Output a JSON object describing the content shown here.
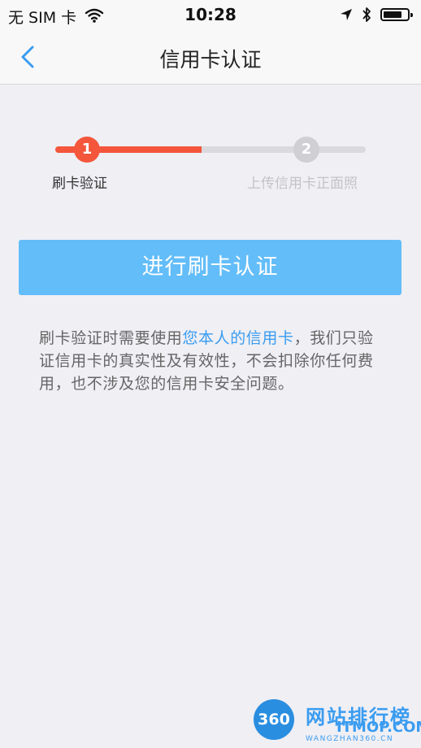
{
  "status_bar": {
    "carrier": "无 SIM 卡",
    "time": "10:28",
    "icons": [
      "wifi-icon",
      "location-arrow-icon",
      "bluetooth-icon",
      "battery-icon"
    ]
  },
  "nav": {
    "back_icon": "chevron-left-icon",
    "title": "信用卡认证"
  },
  "steps": {
    "progress": 0.47,
    "items": [
      {
        "number": "1",
        "label": "刷卡验证",
        "active": true
      },
      {
        "number": "2",
        "label": "上传信用卡正面照",
        "active": false
      }
    ]
  },
  "action_button": {
    "label": "进行刷卡认证"
  },
  "description": {
    "before": "刷卡验证时需要使用",
    "highlight": "您本人的信用卡",
    "after": "，我们只验证信用卡的真实性及有效性，不会扣除你任何费用，也不涉及您的信用卡安全问题。"
  },
  "watermark": {
    "logo": "360",
    "text_cn": "网站排行榜",
    "text_en": "ITMOP.COM",
    "url": "WANGZHAN360.CN"
  },
  "colors": {
    "accent": "#63bdf8",
    "progress_active": "#f4563c",
    "progress_inactive": "#d9d9de",
    "link": "#3a9cf0",
    "background": "#efeff4"
  }
}
